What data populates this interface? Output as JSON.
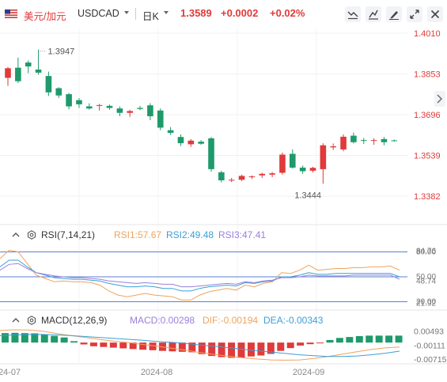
{
  "toolbar": {
    "pair_name": "美元/加元",
    "symbol": "USDCAD",
    "timeframe": "日K",
    "last_price": "1.3589",
    "change": "+0.0002",
    "change_pct": "+0.02%",
    "buttons": [
      "indicator-icon",
      "draw-icon",
      "pencil-icon",
      "fullscreen-icon",
      "close-icon"
    ]
  },
  "colors": {
    "up": "#e03a3a",
    "down": "#1e9a6b",
    "rsi1": "#f0a35e",
    "rsi2": "#3aa0d8",
    "rsi3": "#9b7fdc",
    "macd": "#9b7fdc",
    "dif": "#f0a35e",
    "dea": "#3aa0d8",
    "guide": "#5b7fd6"
  },
  "chart_data": [
    {
      "type": "candlestick",
      "title": "USDCAD",
      "y_ticks": [
        "1.4010",
        "1.3853",
        "1.3696",
        "1.3539",
        "1.3382"
      ],
      "ylim": [
        1.3382,
        1.401
      ],
      "x_ticks": [
        "24-07",
        "2024-08",
        "2024-09"
      ],
      "annotations": [
        {
          "label": "1.3947",
          "kind": "high"
        },
        {
          "label": "1.3444",
          "kind": "low"
        }
      ],
      "candles": [
        [
          1.3838,
          1.388,
          1.3807,
          1.3875
        ],
        [
          1.3877,
          1.3916,
          1.3818,
          1.3825
        ],
        [
          1.3897,
          1.3905,
          1.3856,
          1.3882
        ],
        [
          1.387,
          1.3947,
          1.385,
          1.3858
        ],
        [
          1.3845,
          1.3862,
          1.3768,
          1.3782
        ],
        [
          1.3798,
          1.3802,
          1.376,
          1.377
        ],
        [
          1.3775,
          1.378,
          1.3717,
          1.3728
        ],
        [
          1.3752,
          1.376,
          1.3722,
          1.3736
        ],
        [
          1.3728,
          1.374,
          1.3715,
          1.372
        ],
        [
          1.373,
          1.3738,
          1.3712,
          1.3733
        ],
        [
          1.373,
          1.3735,
          1.3715,
          1.3722
        ],
        [
          1.372,
          1.3728,
          1.369,
          1.3703
        ],
        [
          1.3703,
          1.3715,
          1.3688,
          1.371
        ],
        [
          1.3722,
          1.373,
          1.3713,
          1.3718
        ],
        [
          1.3732,
          1.374,
          1.3675,
          1.369
        ],
        [
          1.3712,
          1.372,
          1.3636,
          1.3646
        ],
        [
          1.3636,
          1.3648,
          1.3618,
          1.3626
        ],
        [
          1.361,
          1.362,
          1.3575,
          1.3586
        ],
        [
          1.3582,
          1.3602,
          1.3572,
          1.3596
        ],
        [
          1.3592,
          1.3598,
          1.358,
          1.3584
        ],
        [
          1.3605,
          1.361,
          1.3476,
          1.3486
        ],
        [
          1.3474,
          1.348,
          1.3435,
          1.3443
        ],
        [
          1.3443,
          1.3452,
          1.3436,
          1.3445
        ],
        [
          1.3445,
          1.3465,
          1.344,
          1.346
        ],
        [
          1.3455,
          1.3462,
          1.3448,
          1.3458
        ],
        [
          1.3462,
          1.3472,
          1.3452,
          1.3468
        ],
        [
          1.3465,
          1.3475,
          1.3455,
          1.347
        ],
        [
          1.3472,
          1.355,
          1.3465,
          1.3542
        ],
        [
          1.3545,
          1.3562,
          1.3488,
          1.3492
        ],
        [
          1.3492,
          1.35,
          1.3468,
          1.3478
        ],
        [
          1.348,
          1.3495,
          1.3473,
          1.3491
        ],
        [
          1.3486,
          1.3586,
          1.343,
          1.3578
        ],
        [
          1.357,
          1.3585,
          1.356,
          1.3574
        ],
        [
          1.3562,
          1.362,
          1.3555,
          1.3611
        ],
        [
          1.3615,
          1.3627,
          1.3585,
          1.359
        ],
        [
          1.3598,
          1.3606,
          1.3583,
          1.3596
        ],
        [
          1.3595,
          1.3605,
          1.358,
          1.3598
        ],
        [
          1.3602,
          1.361,
          1.3578,
          1.359
        ],
        [
          1.3597,
          1.36,
          1.3592,
          1.3596
        ]
      ]
    },
    {
      "type": "line",
      "title": "RSI(7,14,21)",
      "legend": [
        "RSI1:57.67",
        "RSI2:49.48",
        "RSI3:47.41"
      ],
      "y_ticks": [
        "80.00",
        "84.76",
        "50.00",
        "48.74",
        "20.00",
        "21.92"
      ],
      "levels": [
        80,
        50,
        20
      ],
      "ylim": [
        10,
        90
      ],
      "series": [
        {
          "name": "RSI1",
          "values": [
            72,
            82,
            80,
            66,
            52,
            48,
            44,
            45,
            44,
            44,
            43,
            40,
            33,
            28,
            26,
            28,
            30,
            28,
            27,
            26,
            22,
            22,
            28,
            32,
            34,
            36,
            34,
            40,
            38,
            42,
            44,
            55,
            54,
            58,
            64,
            58,
            59,
            60,
            60,
            61,
            61,
            62,
            62,
            63,
            58
          ]
        },
        {
          "name": "RSI2",
          "values": [
            62,
            70,
            70,
            62,
            55,
            52,
            49,
            48,
            47,
            47,
            46,
            45,
            42,
            40,
            38,
            38,
            39,
            38,
            36,
            36,
            33,
            33,
            36,
            38,
            39,
            40,
            39,
            43,
            42,
            44,
            45,
            50,
            50,
            52,
            55,
            53,
            53,
            54,
            54,
            54,
            54,
            54,
            54,
            54,
            50
          ]
        },
        {
          "name": "RSI3",
          "values": [
            58,
            65,
            66,
            60,
            55,
            53,
            51,
            50,
            49,
            49,
            48,
            47,
            45,
            44,
            43,
            42,
            43,
            42,
            41,
            41,
            38,
            38,
            39,
            40,
            41,
            42,
            41,
            44,
            43,
            45,
            46,
            49,
            49,
            50,
            52,
            51,
            51,
            51,
            51,
            52,
            52,
            52,
            52,
            52,
            47
          ]
        }
      ]
    },
    {
      "type": "bar",
      "title": "MACD(12,26,9)",
      "legend": [
        "MACD:0.00298",
        "DIF:-0.00194",
        "DEA:-0.00343"
      ],
      "y_ticks": [
        "0.00493",
        "-0.00111",
        "-0.00715"
      ],
      "ylim": [
        -0.0085,
        0.0062
      ],
      "bar_values": [
        0.0041,
        0.0042,
        0.0041,
        0.004,
        0.0035,
        0.0029,
        0.0022,
        0.0006,
        -0.0008,
        -0.0016,
        -0.0019,
        -0.0022,
        -0.0025,
        -0.0028,
        -0.0031,
        -0.0033,
        -0.0036,
        -0.0038,
        -0.004,
        -0.0042,
        -0.005,
        -0.0058,
        -0.0063,
        -0.0066,
        -0.0066,
        -0.006,
        -0.0056,
        -0.0049,
        -0.0036,
        -0.0024,
        -0.0013,
        -0.0007,
        -0.0003,
        0.0011,
        0.002,
        0.0024,
        0.0028,
        0.003,
        0.003,
        0.003,
        0.003
      ],
      "series": [
        {
          "name": "DIF",
          "values": [
            0.0052,
            0.0055,
            0.0054,
            0.0049,
            0.0039,
            0.003,
            0.0022,
            0.0013,
            0.0006,
            0.0,
            -0.0008,
            -0.0016,
            -0.0024,
            -0.0033,
            -0.0043,
            -0.0051,
            -0.0059,
            -0.0066,
            -0.0071,
            -0.0075,
            -0.0076,
            -0.0075,
            -0.0069,
            -0.006,
            -0.005,
            -0.004,
            -0.003,
            -0.0023,
            -0.0019
          ]
        },
        {
          "name": "DEA",
          "values": [
            0.003,
            0.0033,
            0.0035,
            0.0035,
            0.0033,
            0.003,
            0.0026,
            0.0022,
            0.0018,
            0.0014,
            0.001,
            0.0005,
            0.0001,
            -0.0004,
            -0.001,
            -0.0016,
            -0.0022,
            -0.0029,
            -0.0035,
            -0.0041,
            -0.0047,
            -0.0053,
            -0.0057,
            -0.006,
            -0.006,
            -0.0058,
            -0.0053,
            -0.0046,
            -0.0037
          ]
        }
      ]
    }
  ]
}
